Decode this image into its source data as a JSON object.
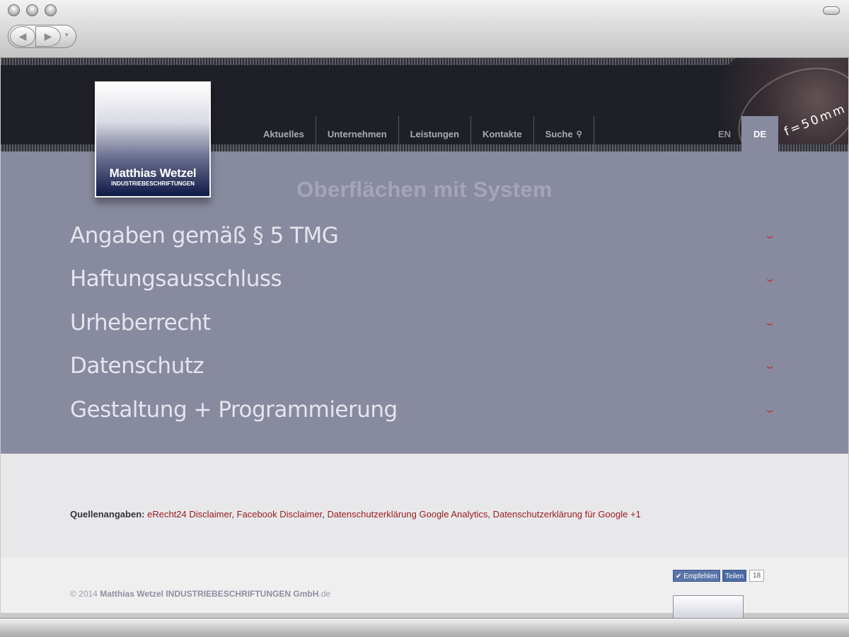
{
  "browser": {
    "back_glyph": "◀",
    "forward_glyph": "▶",
    "dropdown_glyph": "▾"
  },
  "header": {
    "nav": [
      {
        "label": "Aktuelles"
      },
      {
        "label": "Unternehmen"
      },
      {
        "label": "Leistungen"
      },
      {
        "label": "Kontakte"
      },
      {
        "label": "Suche"
      }
    ],
    "search_icon": "⚲",
    "lang_en": "EN",
    "lang_de": "DE",
    "deco_text": "f=50mm"
  },
  "logo": {
    "name": "Matthias Wetzel",
    "subtitle": "INDUSTRIEBESCHRIFTUNGEN"
  },
  "content": {
    "tagline": "Oberflächen mit System",
    "chevron": "⌄",
    "sections": [
      {
        "title": "Angaben gemäß § 5 TMG"
      },
      {
        "title": "Haftungsausschluss"
      },
      {
        "title": "Urheberrecht"
      },
      {
        "title": "Datenschutz"
      },
      {
        "title": "Gestaltung + Programmierung"
      }
    ]
  },
  "footer": {
    "sources_label": "Quellenangaben:",
    "sources": [
      {
        "label": "eRecht24 Disclaimer"
      },
      {
        "label": "Facebook Disclaimer"
      },
      {
        "label": "Datenschutzerklärung Google Analytics"
      },
      {
        "label": "Datenschutzerklärung für Google +1"
      }
    ],
    "separator": ", ",
    "copyright_prefix": "© 2014 ",
    "copyright_company": "Matthias Wetzel INDUSTRIEBESCHRIFTUNGEN GmbH",
    "copyright_suffix": ".de",
    "fb_recommend": "Empfehlen",
    "fb_share": "Teilen",
    "fb_count": "18",
    "fb_check": "✔"
  },
  "colors": {
    "content_bg": "#888aa0",
    "link": "#9a1b1e",
    "header_bg": "#1f2027"
  }
}
